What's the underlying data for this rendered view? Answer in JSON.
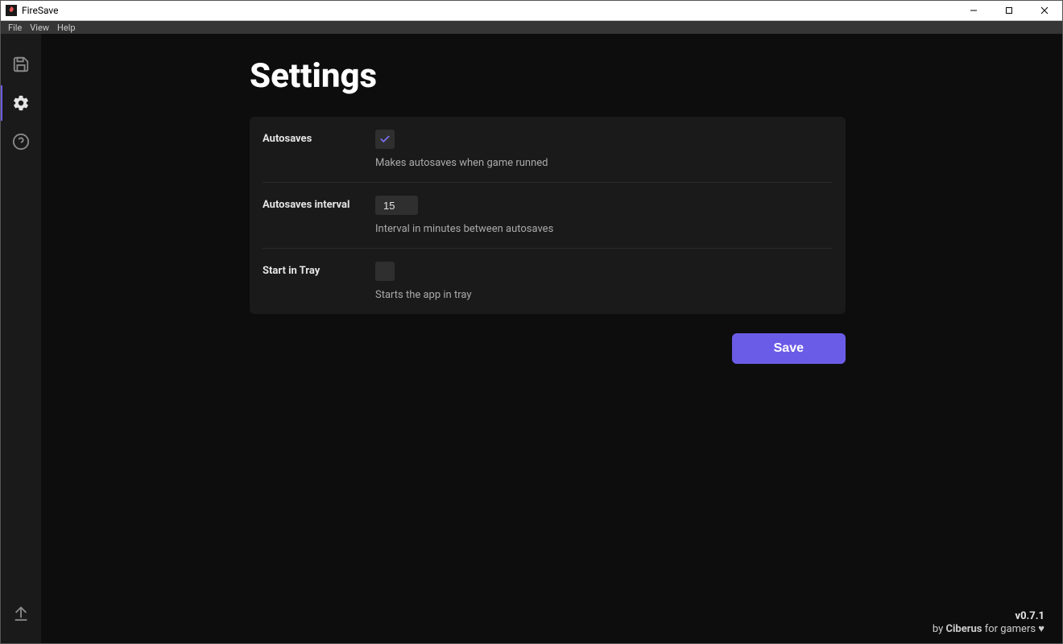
{
  "window": {
    "title": "FireSave",
    "controls": {
      "minimize": "—",
      "maximize": "☐",
      "close": "✕"
    }
  },
  "menubar": {
    "items": [
      "File",
      "View",
      "Help"
    ]
  },
  "sidebar": {
    "items": [
      {
        "name": "saves",
        "active": false
      },
      {
        "name": "settings",
        "active": true
      },
      {
        "name": "help",
        "active": false
      }
    ],
    "bottom": {
      "name": "upload"
    }
  },
  "page": {
    "title": "Settings"
  },
  "settings": {
    "rows": [
      {
        "label": "Autosaves",
        "type": "checkbox",
        "checked": true,
        "description": "Makes autosaves when game runned"
      },
      {
        "label": "Autosaves interval",
        "type": "number",
        "value": "15",
        "description": "Interval in minutes between autosaves"
      },
      {
        "label": "Start in Tray",
        "type": "checkbox",
        "checked": false,
        "description": "Starts the app in tray"
      }
    ]
  },
  "actions": {
    "save": "Save"
  },
  "footer": {
    "version": "v0.7.1",
    "by": "by ",
    "author": "Ciberus",
    "suffix": " for gamers ♥"
  }
}
